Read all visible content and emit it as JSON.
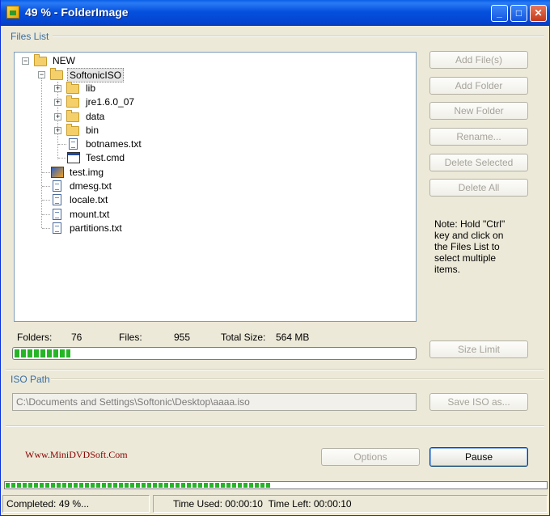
{
  "window": {
    "title": "49 % - FolderImage"
  },
  "files_list": {
    "label": "Files List",
    "tree": [
      {
        "name": "NEW",
        "type": "folder"
      },
      {
        "name": "SoftonicISO",
        "type": "folder"
      },
      {
        "name": "lib",
        "type": "folder"
      },
      {
        "name": "jre1.6.0_07",
        "type": "folder"
      },
      {
        "name": "data",
        "type": "folder"
      },
      {
        "name": "bin",
        "type": "folder"
      },
      {
        "name": "botnames.txt",
        "type": "file"
      },
      {
        "name": "Test.cmd",
        "type": "cmd"
      },
      {
        "name": "test.img",
        "type": "img"
      },
      {
        "name": "dmesg.txt",
        "type": "file"
      },
      {
        "name": "locale.txt",
        "type": "file"
      },
      {
        "name": "mount.txt",
        "type": "file"
      },
      {
        "name": "partitions.txt",
        "type": "file"
      }
    ],
    "buttons": {
      "add_files": "Add File(s)",
      "add_folder": "Add Folder",
      "new_folder": "New Folder",
      "rename": "Rename...",
      "delete_selected": "Delete Selected",
      "delete_all": "Delete All"
    },
    "note": "Note: Hold \"Ctrl\" key and click on the Files List to select multiple items.",
    "stats": {
      "folders_label": "Folders:",
      "folders_value": "76",
      "files_label": "Files:",
      "files_value": "955",
      "total_size_label": "Total Size:",
      "total_size_value": "564 MB"
    },
    "size_progress_fraction": 0.14,
    "size_limit_button": "Size Limit"
  },
  "iso_path": {
    "label": "ISO Path",
    "value": "C:\\Documents and Settings\\Softonic\\Desktop\\aaaa.iso",
    "save_button": "Save ISO as..."
  },
  "footer": {
    "website": "Www.MiniDVDSoft.Com",
    "options_button": "Options",
    "pause_button": "Pause"
  },
  "progress": {
    "percent": 49
  },
  "status": {
    "completed": "Completed: 49 %...",
    "time_used": "Time Used: 00:00:10",
    "time_left": "Time Left: 00:00:10"
  },
  "colors": {
    "accent": "#0550de",
    "progress": "#26b526",
    "group_label": "#3a6ea5",
    "link": "#8b0000"
  }
}
